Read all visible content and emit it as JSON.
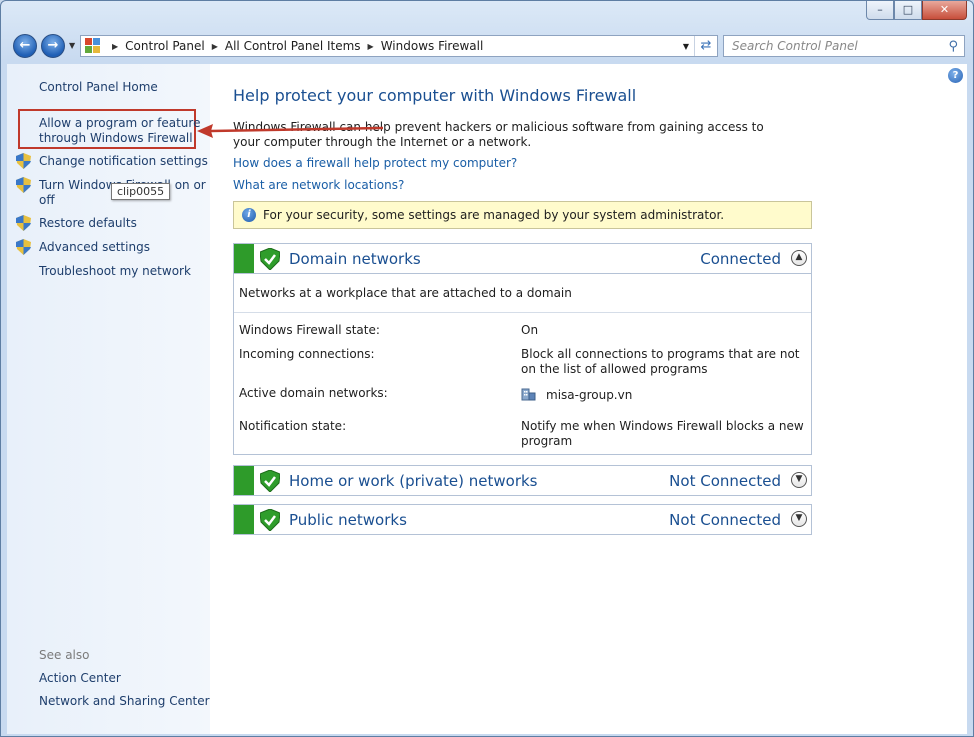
{
  "window": {
    "controls": {
      "minimize": "–",
      "maximize": "□",
      "close": "✕"
    }
  },
  "navigation": {
    "back_icon": "back-arrow-icon",
    "forward_icon": "forward-arrow-icon",
    "breadcrumbs": [
      "Control Panel",
      "All Control Panel Items",
      "Windows Firewall"
    ],
    "search_placeholder": "Search Control Panel"
  },
  "sidebar": {
    "home": "Control Panel Home",
    "items": [
      {
        "label_line1": "Allow a program or feature",
        "label_line2": "through Windows Firewall",
        "shield": false
      },
      {
        "label": "Change notification settings",
        "shield": true
      },
      {
        "label_line1": "Turn Windows Firewall on or",
        "label_line2": "off",
        "shield": true
      },
      {
        "label": "Restore defaults",
        "shield": true
      },
      {
        "label": "Advanced settings",
        "shield": true
      },
      {
        "label": "Troubleshoot my network",
        "shield": false
      }
    ],
    "tooltip": "clip0055",
    "see_also_heading": "See also",
    "see_also": [
      "Action Center",
      "Network and Sharing Center"
    ]
  },
  "main": {
    "title": "Help protect your computer with Windows Firewall",
    "description": "Windows Firewall can help prevent hackers or malicious software from gaining access to your computer through the Internet or a network.",
    "links": [
      "How does a firewall help protect my computer?",
      "What are network locations?"
    ],
    "info_message": "For your security, some settings are managed by your system administrator.",
    "networks": [
      {
        "name": "Domain networks",
        "status": "Connected",
        "expanded": true,
        "description": "Networks at a workplace that are attached to a domain",
        "details": [
          {
            "label": "Windows Firewall state:",
            "value": "On"
          },
          {
            "label": "Incoming connections:",
            "value": "Block all connections to programs that are not on the list of allowed programs"
          },
          {
            "label": "Active domain networks:",
            "value": "misa-group.vn"
          },
          {
            "label": "Notification state:",
            "value": "Notify me when Windows Firewall blocks a new program"
          }
        ]
      },
      {
        "name": "Home or work (private) networks",
        "status": "Not Connected",
        "expanded": false
      },
      {
        "name": "Public networks",
        "status": "Not Connected",
        "expanded": false
      }
    ]
  },
  "colors": {
    "accent_link": "#1a5ea6",
    "status_green": "#2e9b2a",
    "annotation_red": "#c0392b",
    "info_bg": "#fffbcc"
  }
}
